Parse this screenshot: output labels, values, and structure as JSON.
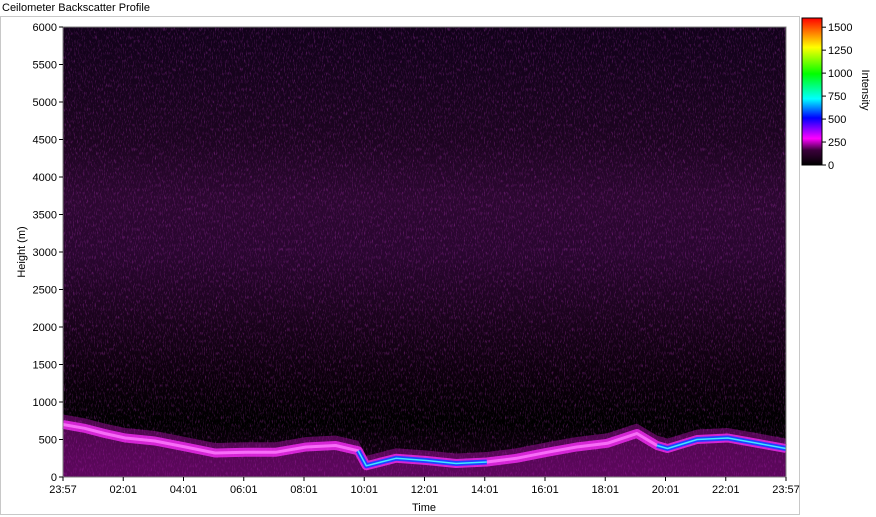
{
  "window": {
    "title": "Ceilometer Backscatter Profile"
  },
  "chart_data": {
    "type": "heatmap",
    "title": "",
    "xlabel": "Time",
    "ylabel": "Height (m)",
    "x_ticks": [
      "23:57",
      "02:01",
      "04:01",
      "06:01",
      "08:01",
      "10:01",
      "12:01",
      "14:01",
      "16:01",
      "18:01",
      "20:01",
      "22:01",
      "23:57"
    ],
    "y_ticks": [
      0,
      500,
      1000,
      1500,
      2000,
      2500,
      3000,
      3500,
      4000,
      4500,
      5000,
      5500,
      6000
    ],
    "ylim": [
      0,
      6000
    ],
    "colorbar": {
      "label": "Intensity",
      "ticks": [
        0,
        250,
        500,
        750,
        1000,
        1250,
        1500
      ],
      "range": [
        0,
        1600
      ],
      "colors": [
        "#000000",
        "#ff00ff",
        "#0000ff",
        "#00ffff",
        "#00ff00",
        "#ffff00",
        "#ff0000"
      ]
    },
    "boundary_layer_height_m": [
      {
        "time": "23:57",
        "height": 700
      },
      {
        "time": "00:40",
        "height": 650
      },
      {
        "time": "01:20",
        "height": 580
      },
      {
        "time": "02:01",
        "height": 520
      },
      {
        "time": "03:00",
        "height": 480
      },
      {
        "time": "04:01",
        "height": 400
      },
      {
        "time": "05:00",
        "height": 320
      },
      {
        "time": "06:01",
        "height": 330
      },
      {
        "time": "07:00",
        "height": 330
      },
      {
        "time": "08:01",
        "height": 400
      },
      {
        "time": "09:00",
        "height": 420
      },
      {
        "time": "09:45",
        "height": 350
      },
      {
        "time": "10:01",
        "height": 150
      },
      {
        "time": "11:00",
        "height": 250
      },
      {
        "time": "12:01",
        "height": 220
      },
      {
        "time": "13:00",
        "height": 180
      },
      {
        "time": "14:01",
        "height": 200
      },
      {
        "time": "15:00",
        "height": 250
      },
      {
        "time": "16:01",
        "height": 330
      },
      {
        "time": "17:00",
        "height": 400
      },
      {
        "time": "18:01",
        "height": 450
      },
      {
        "time": "19:00",
        "height": 580
      },
      {
        "time": "19:40",
        "height": 420
      },
      {
        "time": "20:01",
        "height": 380
      },
      {
        "time": "21:00",
        "height": 500
      },
      {
        "time": "22:01",
        "height": 520
      },
      {
        "time": "23:00",
        "height": 450
      },
      {
        "time": "23:57",
        "height": 380
      }
    ]
  }
}
